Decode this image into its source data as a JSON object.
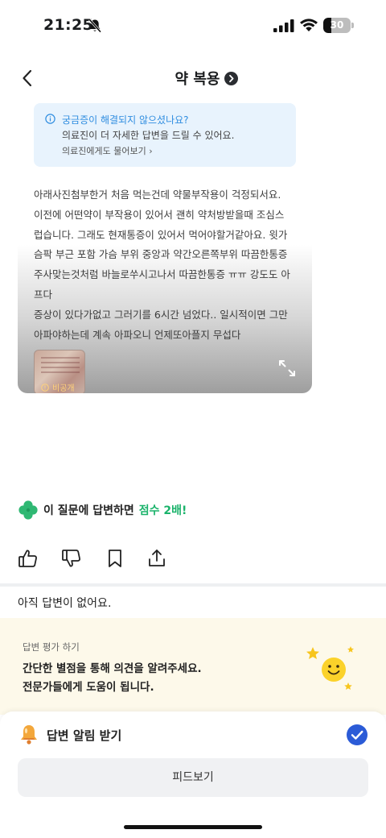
{
  "status": {
    "time": "21:25",
    "battery_level": "30",
    "icons": [
      "bell-off-icon",
      "cellular-signal-icon",
      "wifi-icon",
      "battery-icon"
    ]
  },
  "nav": {
    "title": "약 복용",
    "back_icon": "chevron-left-icon",
    "title_icon": "chevron-right-circle-icon"
  },
  "info_box": {
    "title": "궁금증이 해결되지 않으셨나요?",
    "subtitle": "의료진이 더 자세한 답변을 드릴 수 있어요.",
    "link": "의료진에게도 물어보기  ›"
  },
  "question": {
    "lines": [
      "아래사진첨부한거 처음 먹는건데 약물부작용이 걱정되서요.",
      "이전에 어떤약이 부작용이 있어서 괜히 약처방받을때 조심스",
      "럽습니다. 그래도 현재통증이 있어서 먹어야할거같아요. 윗가",
      "슴팍 부근 포함 가슴 부위 중앙과 약간오른쪽부위 따끔한통증",
      "주사맞는것처럼 바늘로쑤시고나서 따끔한통증 ㅠㅠ 강도도 아",
      "프다",
      "증상이 있다가없고 그러기를 6시간 넘었다.. 일시적이면 그만",
      "아파야하는데 계속 아파오니 언제또아플지 무섭다"
    ],
    "attachment_badge": "비공개",
    "expand_icon": "expand-icon"
  },
  "promo": {
    "text": "이 질문에 답변하면",
    "highlight": "점수 2배!",
    "icon": "clover-icon",
    "highlight_color": "#1bb36b"
  },
  "actions": [
    "thumbs-up-icon",
    "thumbs-down-icon",
    "bookmark-icon",
    "share-icon"
  ],
  "answers": {
    "empty_text": "아직 답변이 없어요."
  },
  "rating": {
    "label": "답변 평가 하기",
    "line1": "간단한 별점을 통해 의견을 알려주세요.",
    "line2": "전문가들에게 도움이 됩니다."
  },
  "bottom": {
    "alarm_label": "답변 알림 받기",
    "alarm_checked": true,
    "feed_button": "피드보기"
  },
  "colors": {
    "accent_blue": "#2f8de0",
    "info_bg": "#e8f3fd",
    "rating_bg": "#fdf9ea",
    "check_blue": "#2b5bd7"
  }
}
